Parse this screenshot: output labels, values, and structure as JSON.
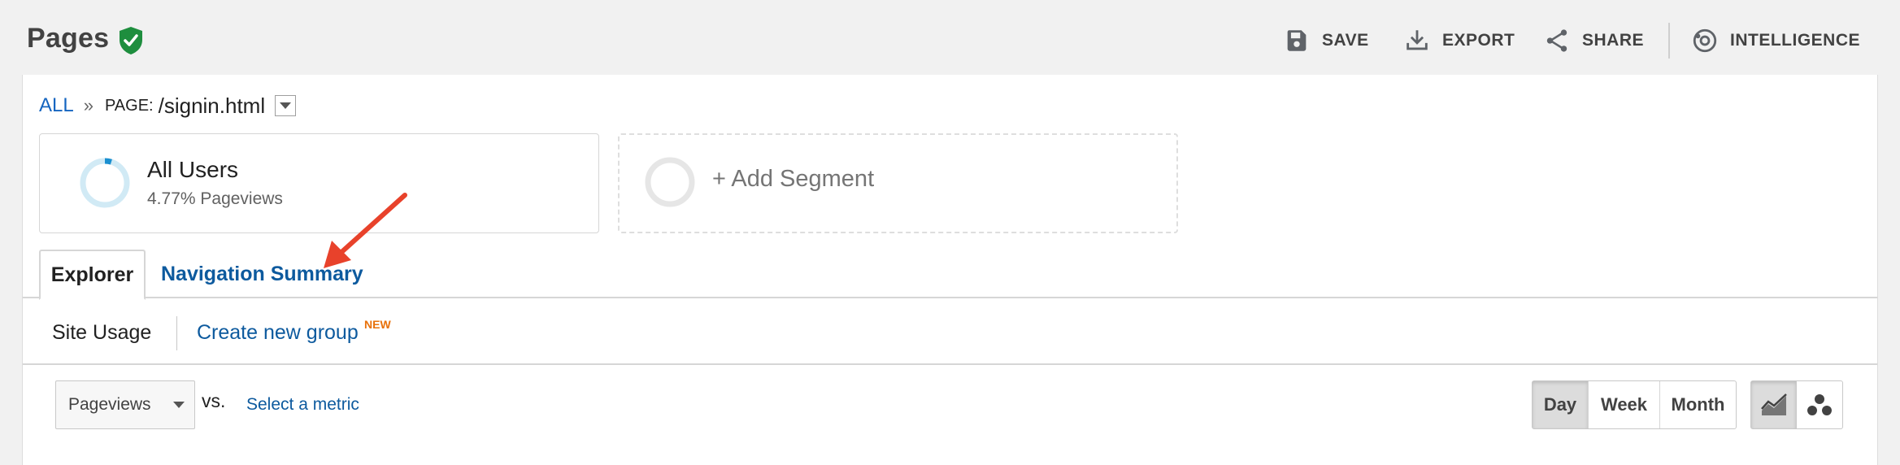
{
  "header": {
    "title": "Pages",
    "actions": {
      "save": "SAVE",
      "export": "EXPORT",
      "share": "SHARE",
      "intelligence": "INTELLIGENCE"
    }
  },
  "breadcrumb": {
    "all": "ALL",
    "separator": "»",
    "key": "PAGE:",
    "value": "/signin.html"
  },
  "segments": [
    {
      "name": "All Users",
      "subtitle": "4.77% Pageviews"
    },
    {
      "add_label": "+ Add Segment"
    }
  ],
  "tabs": {
    "explorer": "Explorer",
    "navigation_summary": "Navigation Summary"
  },
  "subtabs": {
    "site_usage": "Site Usage",
    "create_group": "Create new group",
    "new_badge": "NEW"
  },
  "controls": {
    "metric_selected": "Pageviews",
    "vs": "vs.",
    "select_metric": "Select a metric",
    "periods": [
      "Day",
      "Week",
      "Month"
    ],
    "active_period": "Day"
  },
  "colors": {
    "link": "#0d5a9e",
    "verified": "#1e8e3e",
    "annotation_arrow": "#e8422b",
    "segment_ring": "#d1eaf5"
  },
  "icons": [
    "verified-shield-icon",
    "save-icon",
    "export-icon",
    "share-icon",
    "intelligence-icon",
    "line-chart-icon",
    "motion-chart-icon"
  ]
}
